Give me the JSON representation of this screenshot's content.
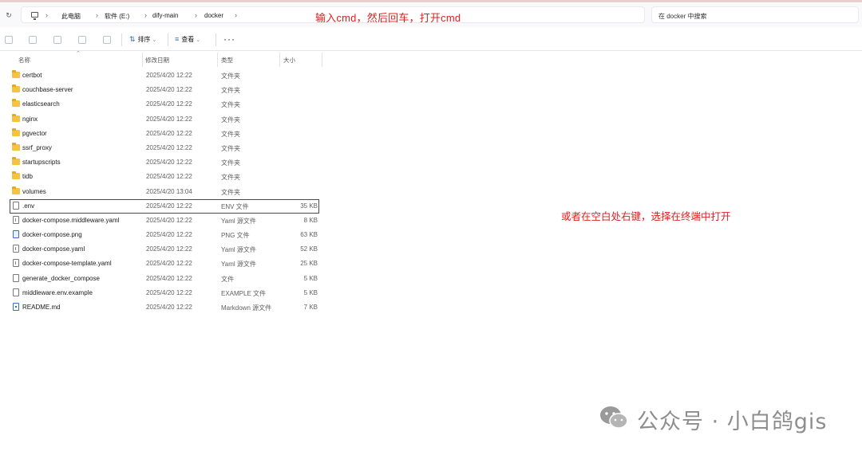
{
  "breadcrumb": [
    "此电脑",
    "软件 (E:)",
    "dify-main",
    "docker"
  ],
  "annotation_top": "输入cmd，然后回车，打开cmd",
  "annotation_right": "或者在空白处右键，选择在终端中打开",
  "search": {
    "placeholder": "在 docker 中搜索"
  },
  "toolbar": {
    "sort_label": "排序",
    "view_label": "查看",
    "more_label": "···"
  },
  "columns": {
    "name": "名称",
    "date": "修改日期",
    "type": "类型",
    "size": "大小"
  },
  "files": [
    {
      "name": "certbot",
      "date": "2025/4/20 12:22",
      "type": "文件夹",
      "size": ""
    },
    {
      "name": "couchbase-server",
      "date": "2025/4/20 12:22",
      "type": "文件夹",
      "size": ""
    },
    {
      "name": "elasticsearch",
      "date": "2025/4/20 12:22",
      "type": "文件夹",
      "size": ""
    },
    {
      "name": "nginx",
      "date": "2025/4/20 12:22",
      "type": "文件夹",
      "size": ""
    },
    {
      "name": "pgvector",
      "date": "2025/4/20 12:22",
      "type": "文件夹",
      "size": ""
    },
    {
      "name": "ssrf_proxy",
      "date": "2025/4/20 12:22",
      "type": "文件夹",
      "size": ""
    },
    {
      "name": "startupscripts",
      "date": "2025/4/20 12:22",
      "type": "文件夹",
      "size": ""
    },
    {
      "name": "tidb",
      "date": "2025/4/20 12:22",
      "type": "文件夹",
      "size": ""
    },
    {
      "name": "volumes",
      "date": "2025/4/20 13:04",
      "type": "文件夹",
      "size": ""
    },
    {
      "name": ".env",
      "date": "2025/4/20 12:22",
      "type": "ENV 文件",
      "size": "35 KB"
    },
    {
      "name": "docker-compose.middleware.yaml",
      "date": "2025/4/20 12:22",
      "type": "Yaml 源文件",
      "size": "8 KB"
    },
    {
      "name": "docker-compose.png",
      "date": "2025/4/20 12:22",
      "type": "PNG 文件",
      "size": "63 KB"
    },
    {
      "name": "docker-compose.yaml",
      "date": "2025/4/20 12:22",
      "type": "Yaml 源文件",
      "size": "52 KB"
    },
    {
      "name": "docker-compose-template.yaml",
      "date": "2025/4/20 12:22",
      "type": "Yaml 源文件",
      "size": "25 KB"
    },
    {
      "name": "generate_docker_compose",
      "date": "2025/4/20 12:22",
      "type": "文件",
      "size": "5 KB"
    },
    {
      "name": "middleware.env.example",
      "date": "2025/4/20 12:22",
      "type": "EXAMPLE 文件",
      "size": "5 KB"
    },
    {
      "name": "README.md",
      "date": "2025/4/20 12:22",
      "type": "Markdown 源文件",
      "size": "7 KB"
    }
  ],
  "watermark": "公众号 · 小白鸽gis",
  "colors": {
    "annotation": "#e02020",
    "folder": "#f5c242",
    "accent": "#3b6fb6"
  }
}
